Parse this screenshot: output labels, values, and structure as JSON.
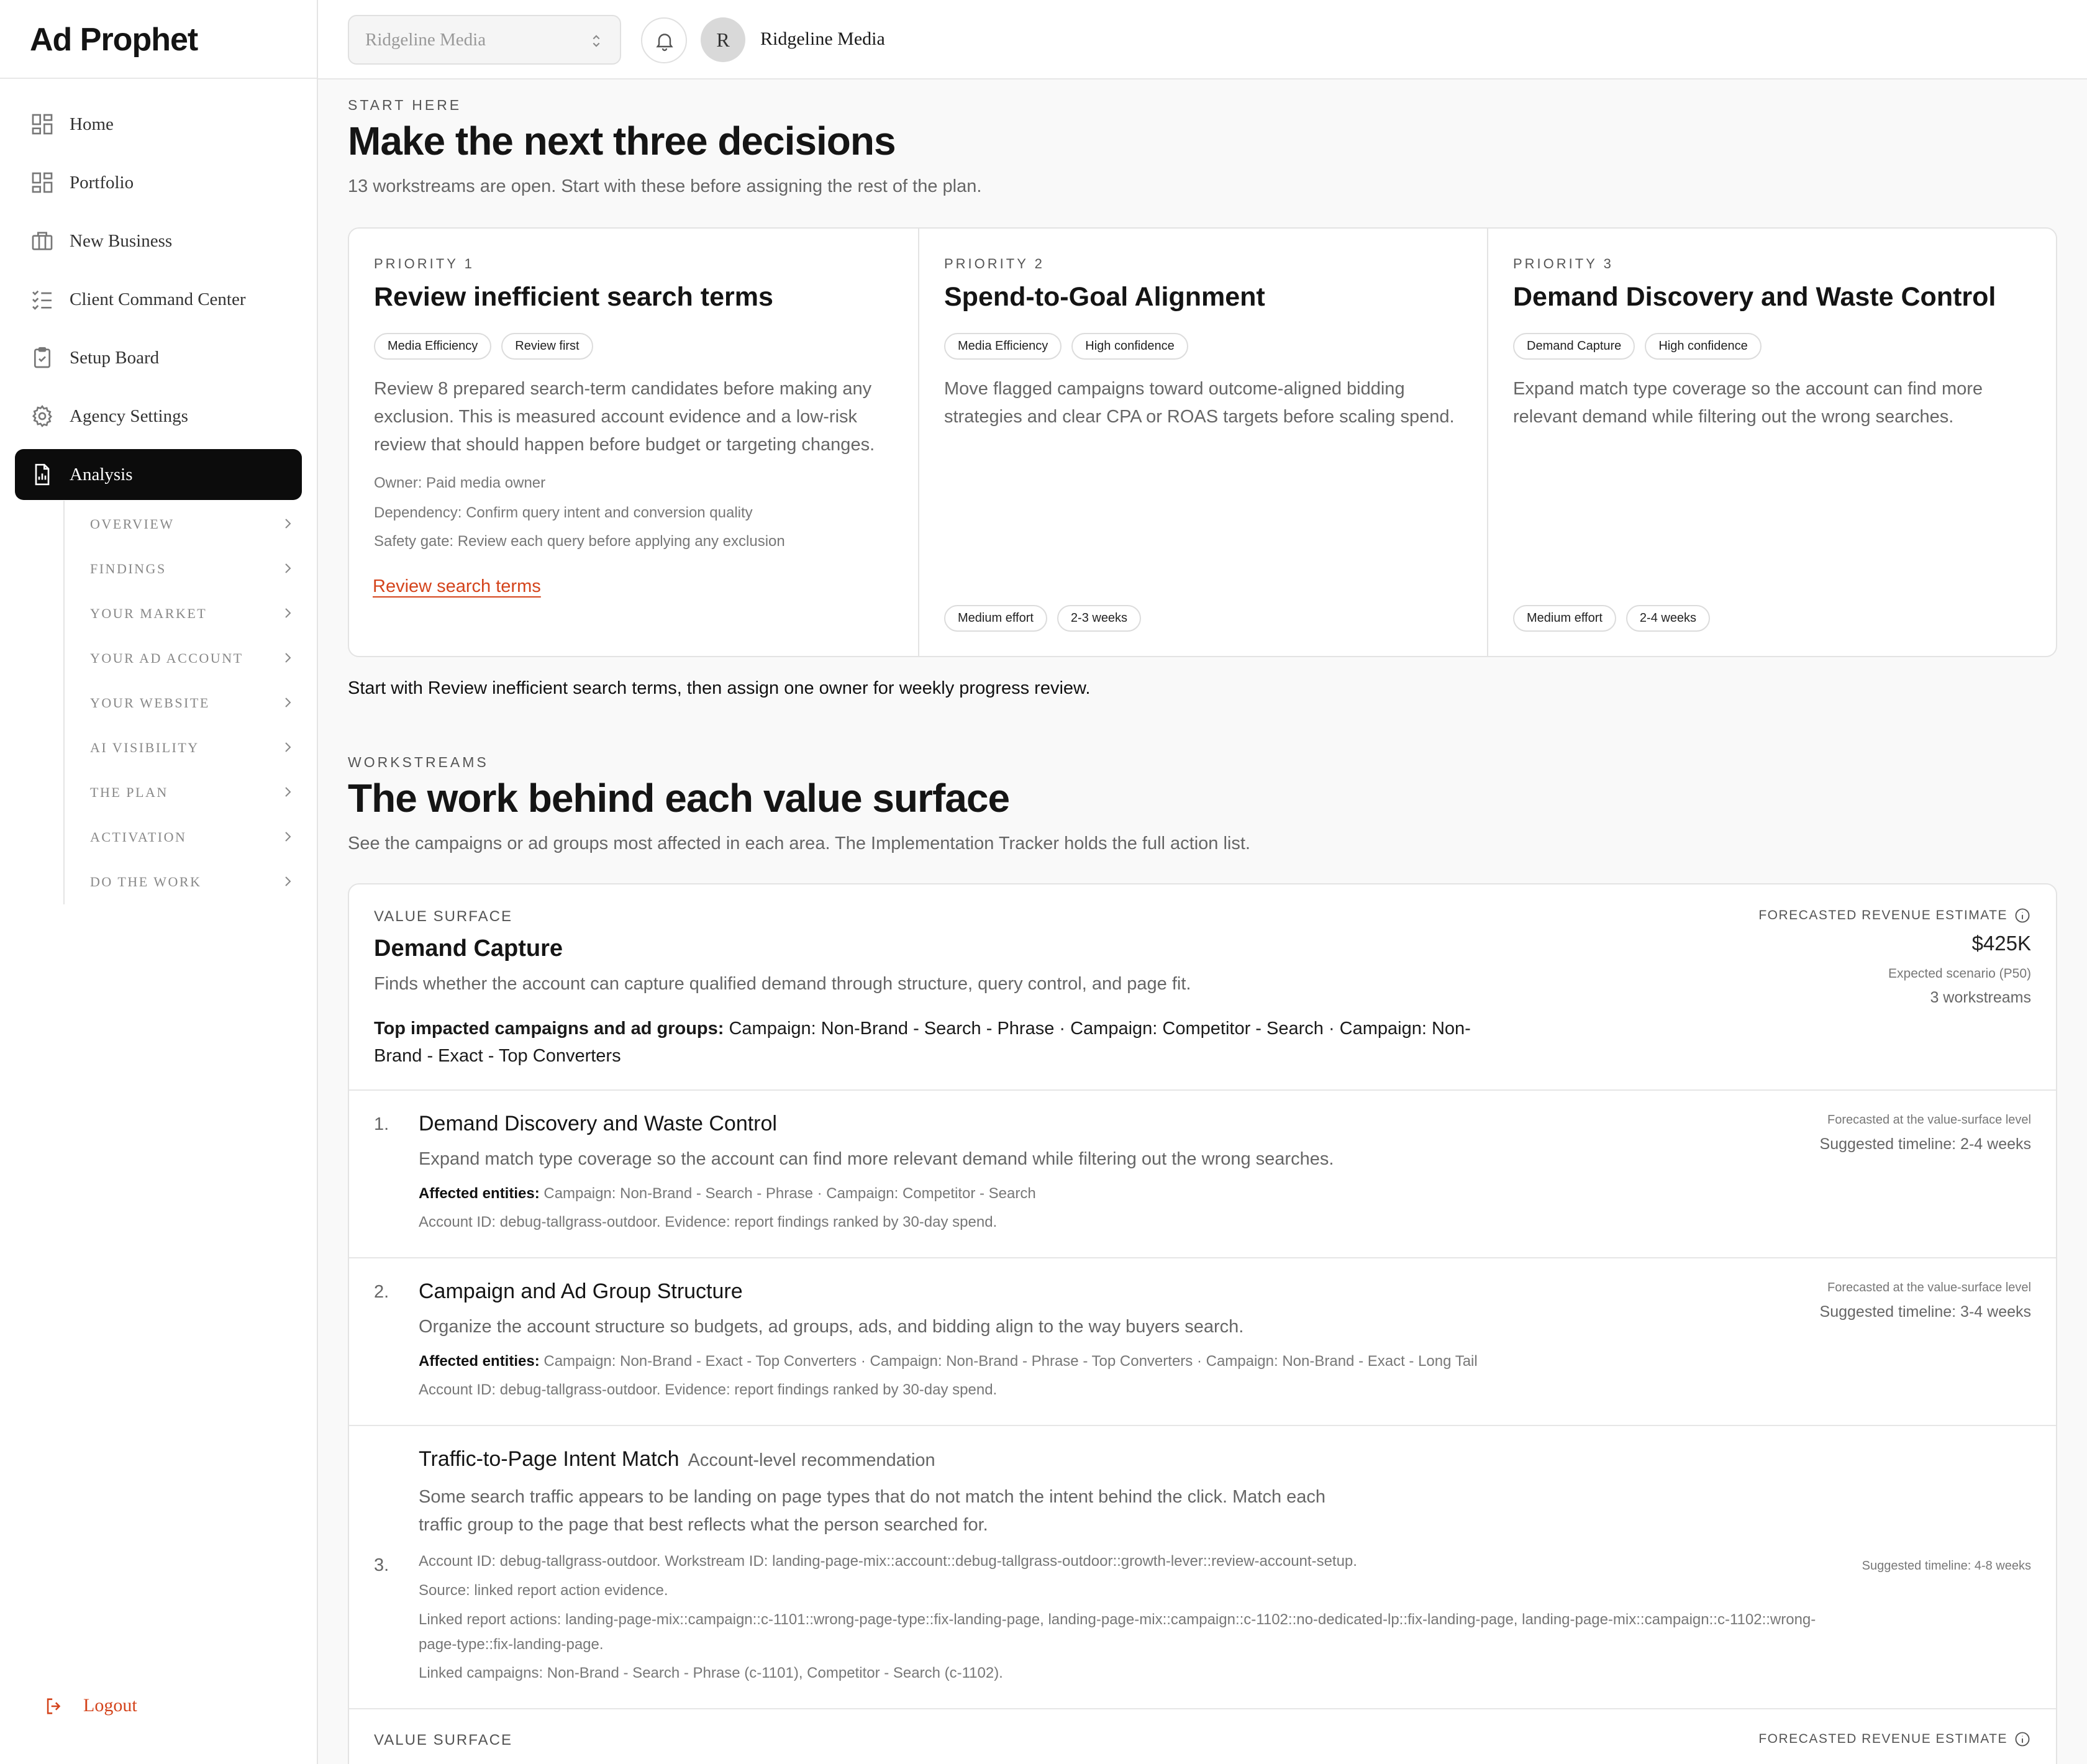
{
  "app": {
    "logo": "Ad Prophet"
  },
  "sidebar": {
    "items": [
      {
        "label": "Home",
        "icon": "grid-icon"
      },
      {
        "label": "Portfolio",
        "icon": "grid-icon"
      },
      {
        "label": "New Business",
        "icon": "briefcase-icon"
      },
      {
        "label": "Client Command Center",
        "icon": "list-check-icon"
      },
      {
        "label": "Setup Board",
        "icon": "clipboard-check-icon"
      },
      {
        "label": "Agency Settings",
        "icon": "gear-icon"
      },
      {
        "label": "Analysis",
        "icon": "report-icon",
        "active": true
      }
    ],
    "subitems": [
      "OVERVIEW",
      "FINDINGS",
      "YOUR MARKET",
      "YOUR AD ACCOUNT",
      "YOUR WEBSITE",
      "AI VISIBILITY",
      "THE PLAN",
      "ACTIVATION",
      "DO THE WORK"
    ],
    "logout": "Logout"
  },
  "topbar": {
    "workspace_select": "Ridgeline Media",
    "avatar_initial": "R",
    "user_name": "Ridgeline Media"
  },
  "start": {
    "eyebrow": "START HERE",
    "title": "Make the next three decisions",
    "subtitle": "13 workstreams are open. Start with these before assigning the rest of the plan.",
    "priorities": [
      {
        "eyebrow": "PRIORITY 1",
        "title": "Review inefficient search terms",
        "tags": [
          "Media Efficiency",
          "Review first"
        ],
        "description": "Review 8 prepared search-term candidates before making any exclusion. This is measured account evidence and a low-risk review that should happen before budget or targeting changes.",
        "meta": [
          "Owner: Paid media owner",
          "Dependency: Confirm query intent and conversion quality",
          "Safety gate: Review each query before applying any exclusion"
        ],
        "link": "Review search terms"
      },
      {
        "eyebrow": "PRIORITY 2",
        "title": "Spend-to-Goal Alignment",
        "tags": [
          "Media Efficiency",
          "High confidence"
        ],
        "description": "Move flagged campaigns toward outcome-aligned bidding strategies and clear CPA or ROAS targets before scaling spend.",
        "footer_tags": [
          "Medium effort",
          "2-3 weeks"
        ]
      },
      {
        "eyebrow": "PRIORITY 3",
        "title": "Demand Discovery and Waste Control",
        "tags": [
          "Demand Capture",
          "High confidence"
        ],
        "description": "Expand match type coverage so the account can find more relevant demand while filtering out the wrong searches.",
        "footer_tags": [
          "Medium effort",
          "2-4 weeks"
        ]
      }
    ],
    "note": "Start with Review inefficient search terms, then assign one owner for weekly progress review."
  },
  "workstreams": {
    "eyebrow": "WORKSTREAMS",
    "title": "The work behind each value surface",
    "subtitle": "See the campaigns or ad groups most affected in each area. The Implementation Tracker holds the full action list.",
    "surface": {
      "eyebrow": "VALUE SURFACE",
      "title": "Demand Capture",
      "description": "Finds whether the account can capture qualified demand through structure, query control, and page fit.",
      "impacted_label": "Top impacted campaigns and ad groups:",
      "impacted_value": "Campaign: Non-Brand - Search - Phrase · Campaign: Competitor - Search · Campaign: Non-Brand - Exact - Top Converters",
      "forecast_label": "FORECASTED REVENUE ESTIMATE",
      "forecast_value": "$425K",
      "forecast_scenario": "Expected scenario (P50)",
      "forecast_workstreams": "3 workstreams",
      "items": [
        {
          "num": "1.",
          "title": "Demand Discovery and Waste Control",
          "description": "Expand match type coverage so the account can find more relevant demand while filtering out the wrong searches.",
          "affected_label": "Affected entities:",
          "affected_value": "Campaign: Non-Brand - Search - Phrase · Campaign: Competitor - Search",
          "account_line": "Account ID: debug-tallgrass-outdoor. Evidence: report findings ranked by 30-day spend.",
          "forecast_note": "Forecasted at the value-surface level",
          "timeline": "Suggested timeline: 2-4 weeks"
        },
        {
          "num": "2.",
          "title": "Campaign and Ad Group Structure",
          "description": "Organize the account structure so budgets, ad groups, ads, and bidding align to the way buyers search.",
          "affected_label": "Affected entities:",
          "affected_value": "Campaign: Non-Brand - Exact - Top Converters · Campaign: Non-Brand - Phrase - Top Converters · Campaign: Non-Brand - Exact - Long Tail",
          "account_line": "Account ID: debug-tallgrass-outdoor. Evidence: report findings ranked by 30-day spend.",
          "forecast_note": "Forecasted at the value-surface level",
          "timeline": "Suggested timeline: 3-4 weeks"
        },
        {
          "num": "3.",
          "title": "Traffic-to-Page Intent Match",
          "tag": "Account-level recommendation",
          "description": "Some search traffic appears to be landing on page types that do not match the intent behind the click. Match each traffic group to the page that best reflects what the person searched for.",
          "account_line": "Account ID: debug-tallgrass-outdoor. Workstream ID: landing-page-mix::account::debug-tallgrass-outdoor::growth-lever::review-account-setup.",
          "source_line": "Source: linked report action evidence.",
          "linked_actions": "Linked report actions: landing-page-mix::campaign::c-1101::wrong-page-type::fix-landing-page, landing-page-mix::campaign::c-1102::no-dedicated-lp::fix-landing-page, landing-page-mix::campaign::c-1102::wrong-page-type::fix-landing-page.",
          "linked_campaigns": "Linked campaigns: Non-Brand - Search - Phrase (c-1101), Competitor - Search (c-1102).",
          "timeline": "Suggested timeline: 4-8 weeks"
        }
      ]
    },
    "next_surface": {
      "eyebrow": "VALUE SURFACE",
      "forecast_label": "FORECASTED REVENUE ESTIMATE"
    }
  }
}
